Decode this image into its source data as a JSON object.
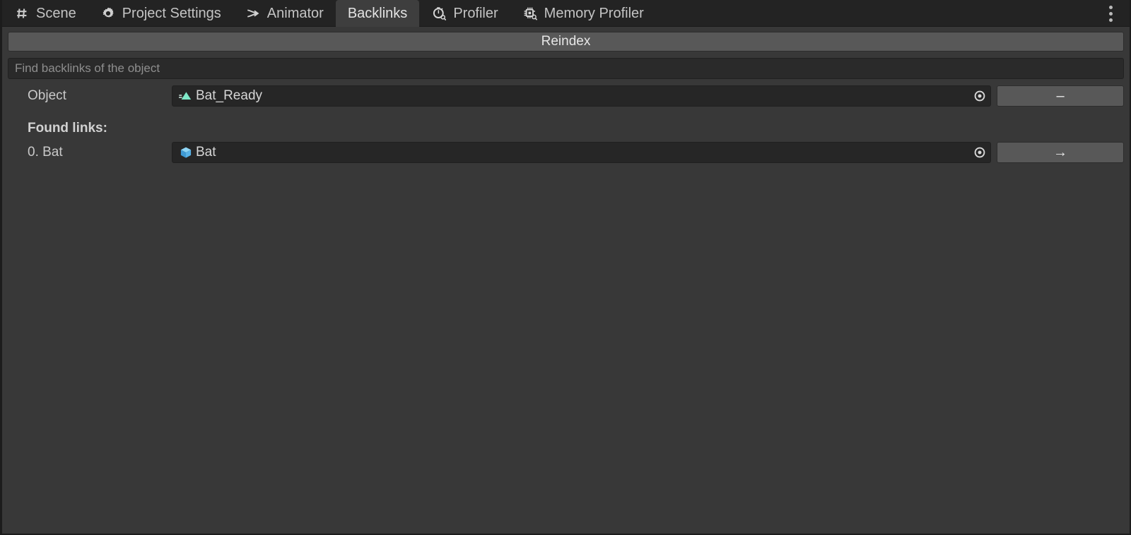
{
  "window": {
    "title": "Backlinks"
  },
  "tabs": [
    {
      "label": "Scene",
      "icon": "grid-icon",
      "active": false
    },
    {
      "label": "Project Settings",
      "icon": "gear-icon",
      "active": false
    },
    {
      "label": "Animator",
      "icon": "animator-arrow-icon",
      "active": false
    },
    {
      "label": "Backlinks",
      "icon": "none",
      "active": true
    },
    {
      "label": "Profiler",
      "icon": "stopwatch-search-icon",
      "active": false
    },
    {
      "label": "Memory Profiler",
      "icon": "chip-search-icon",
      "active": false
    }
  ],
  "tabbar": {
    "overflow_menu": "more-options"
  },
  "toolbar": {
    "reindex_label": "Reindex"
  },
  "search": {
    "value": "",
    "placeholder": "Find backlinks of the object"
  },
  "object_row": {
    "label": "Object",
    "value": "Bat_Ready",
    "icon": "animation-clip-icon",
    "picker_icon": "target-picker-icon",
    "action_label": "–"
  },
  "found_links": {
    "heading": "Found links:",
    "items": [
      {
        "label": "0. Bat",
        "value": "Bat",
        "icon": "prefab-cube-icon",
        "picker_icon": "target-picker-icon",
        "action_label": "→"
      }
    ]
  },
  "colors": {
    "window_background": "#383838",
    "tabbar_background": "#232323",
    "active_tab": "#3e3e3e",
    "button_face": "#585858",
    "field_background": "#262626",
    "text_primary": "#d6d6d6",
    "text_muted": "#8e8e8e",
    "animation_clip_accent": "#7fe8c8",
    "prefab_accent": "#71c4f0"
  }
}
